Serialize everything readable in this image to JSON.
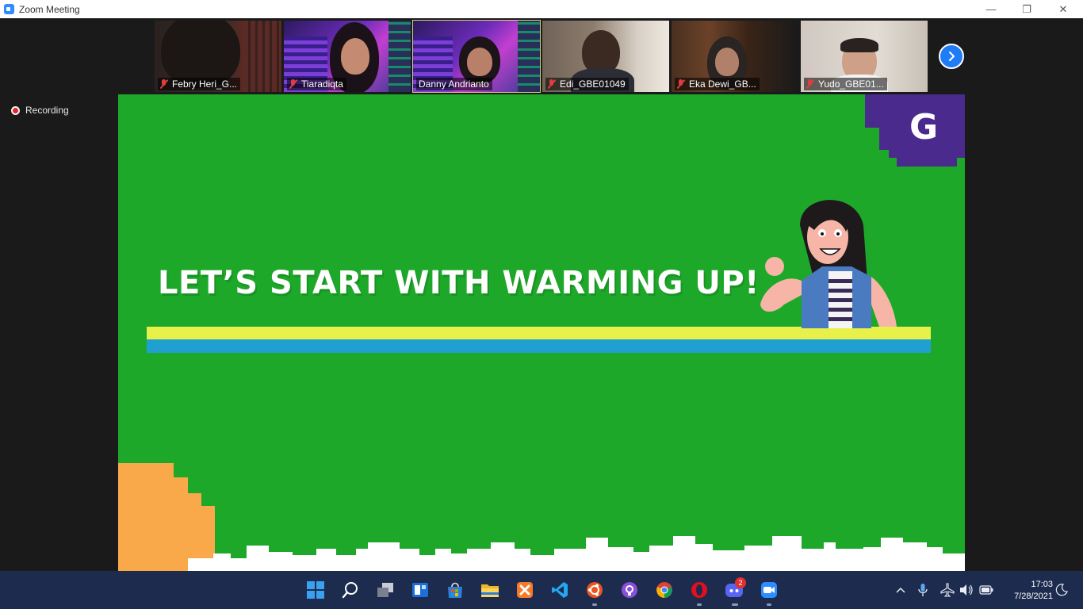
{
  "window": {
    "title": "Zoom Meeting",
    "controls": {
      "minimize": "—",
      "restore": "❐",
      "close": "✕"
    }
  },
  "participants": [
    {
      "name": "Febry Heri_G...",
      "muted": true,
      "active": false
    },
    {
      "name": "Tiaradiqta",
      "muted": true,
      "active": false
    },
    {
      "name": "Danny Andrianto",
      "muted": false,
      "active": true
    },
    {
      "name": "Edi_GBE01049",
      "muted": true,
      "active": false
    },
    {
      "name": "Eka Dewi_GB...",
      "muted": true,
      "active": false
    },
    {
      "name": "Yudo_GBE01...",
      "muted": true,
      "active": false
    }
  ],
  "recording": {
    "label": "Recording"
  },
  "slide": {
    "title": "LET’S START WITH WARMING UP!",
    "logo_letter": "G",
    "colors": {
      "background": "#1ea82a",
      "yellow_stripe": "#e8f04a",
      "blue_stripe": "#20a0d0",
      "logo_purple": "#4a2a8c",
      "orange": "#f9a84a"
    }
  },
  "taskbar": {
    "icons": [
      "start-icon",
      "search-icon",
      "task-view-icon",
      "widgets-icon",
      "store-icon",
      "file-explorer-icon",
      "xampp-icon",
      "vscode-icon",
      "ubuntu-icon",
      "github-icon",
      "chrome-icon",
      "opera-icon",
      "discord-icon",
      "zoom-icon"
    ],
    "discord_badge": "2",
    "clock": {
      "time": "17:03",
      "date": "7/28/2021"
    }
  }
}
